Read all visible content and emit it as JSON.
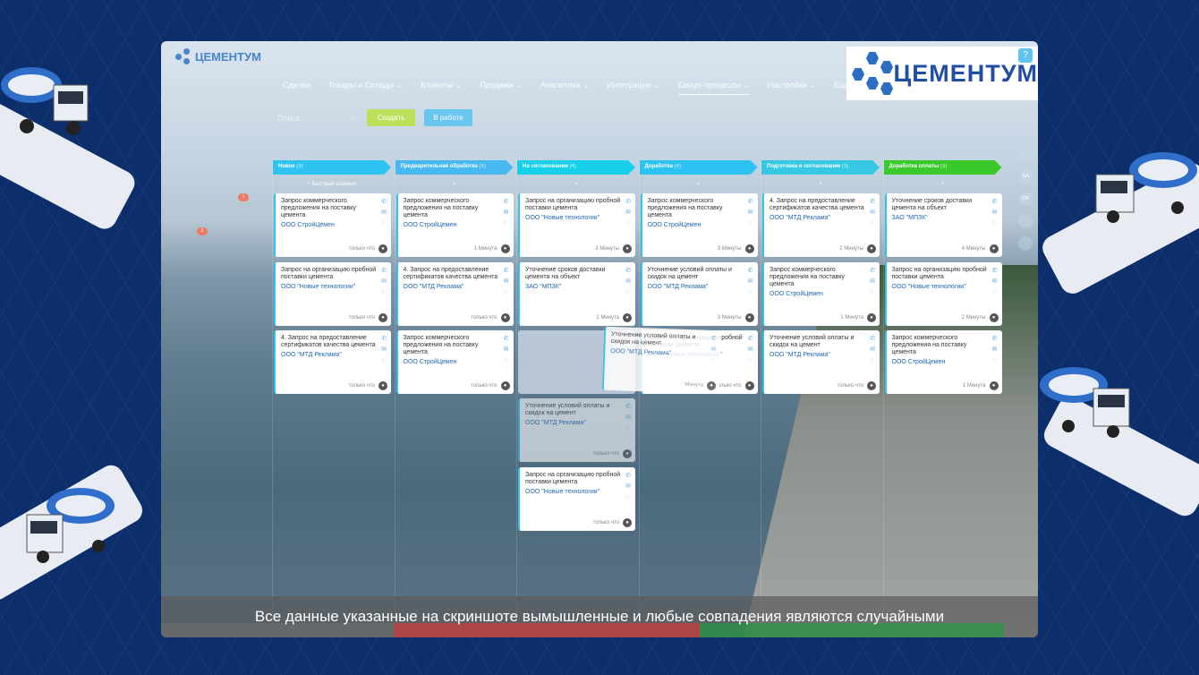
{
  "app": {
    "brand_small": "ЦЕМЕНТУМ",
    "brand_large": "ЦЕМЕНТУМ",
    "help_label": "?"
  },
  "nav": [
    "Сделки",
    "Товары и Склады ⌄",
    "Клиенты ⌄",
    "Продажи ⌄",
    "Аналитика ⌄",
    "Интеграции ⌄",
    "Смарт-процессы ⌄",
    "Настройки ⌄",
    "Ещё"
  ],
  "toolbar": {
    "search_placeholder": "Поиск",
    "create_label": "Создать",
    "work_label": "В работе"
  },
  "right_sidebar": [
    "",
    "АА",
    "ОК",
    "",
    ""
  ],
  "columns": [
    {
      "title": "Новое",
      "count": "(3)",
      "color": "#2ec3f0",
      "add_label": "+ Быстрый элемент"
    },
    {
      "title": "Предварительная обработка",
      "count": "(3)",
      "color": "#48b8f0",
      "add_label": "+"
    },
    {
      "title": "На согласовании",
      "count": "(4)",
      "color": "#15d0e8",
      "add_label": "+"
    },
    {
      "title": "Доработка",
      "count": "(4)",
      "color": "#2cc3f2",
      "add_label": "+"
    },
    {
      "title": "Подготовка и согласование",
      "count": "(3)",
      "color": "#34c8e3",
      "add_label": "+"
    },
    {
      "title": "Доработка оплаты",
      "count": "(3)",
      "color": "#39c92b",
      "add_label": "+"
    }
  ],
  "cards": [
    [
      {
        "title": "Запрос коммерческого предложения на поставку цемента",
        "company": "ООО СтройЦемен",
        "time": "только что"
      },
      {
        "title": "Запрос на организацию пробной поставки цемента",
        "company": "ООО \"Новые технологии\"",
        "time": "только что"
      },
      {
        "title": "4. Запрос на предоставление сертификатов качества цемента",
        "company": "ООО \"МТД Реклама\"",
        "time": "только что"
      }
    ],
    [
      {
        "title": "Запрос коммерческого предложения на поставку цемента",
        "company": "ООО СтройЦемен",
        "time": "1 Минута"
      },
      {
        "title": "4. Запрос на предоставление сертификатов качества цемента",
        "company": "ООО \"МТД Реклама\"",
        "time": "только что"
      },
      {
        "title": "Запрос коммерческого предложения на поставку цемента",
        "company": "ООО СтройЦемен",
        "time": "только что"
      }
    ],
    [
      {
        "title": "Запрос на организацию пробной поставки цемента",
        "company": "ООО \"Новые технологии\"",
        "time": "3 Минуты"
      },
      {
        "title": "Уточнение сроков доставки цемента на объект",
        "company": "ЗАО \"МПЗК\"",
        "time": "1 Минута"
      },
      {
        "title": "Уточнение условий оплаты и скидок на цемент",
        "company": "ООО \"МТД Реклама\"",
        "time": "только что",
        "ghost": true
      },
      {
        "title": "Запрос на организацию пробной поставки цемента",
        "company": "ООО \"Новые технологии\"",
        "time": "только что"
      }
    ],
    [
      {
        "title": "Запрос коммерческого предложения на поставку цемента",
        "company": "ООО СтройЦемен",
        "time": "3 Минуты"
      },
      {
        "title": "Уточнение условий оплаты и скидок на цемент",
        "company": "ООО \"МТД Реклама\"",
        "time": "3 Минуты"
      },
      {
        "title": "Уточнение условий оплаты и скидок на цемент",
        "company": "ООО \"МТД Реклама\"",
        "time": "Минута",
        "dragged": true
      },
      {
        "title": "Запрос на организацию пробной поставки цемента",
        "company": "ООО \"Новые технологии\"",
        "time": "только что"
      }
    ],
    [
      {
        "title": "4. Запрос на предоставление сертификатов качества цемента",
        "company": "ООО \"МТД Реклама\"",
        "time": "2 Минуты"
      },
      {
        "title": "Запрос коммерческого предложения на поставку цемента",
        "company": "ООО СтройЦемен",
        "time": "1 Минута"
      },
      {
        "title": "Уточнение условий оплаты и скидок на цемент",
        "company": "ООО \"МТД Реклама\"",
        "time": "только что"
      }
    ],
    [
      {
        "title": "Уточнение сроков доставки цемента на объект",
        "company": "ЗАО \"МПЗК\"",
        "time": "4 Минуты"
      },
      {
        "title": "Запрос на организацию пробной поставки цемента",
        "company": "ООО \"Новые технологии\"",
        "time": "2 Минуты"
      },
      {
        "title": "Запрос коммерческого предложения на поставку цемента",
        "company": "ООО СтройЦемен",
        "time": "1 Минута"
      }
    ]
  ],
  "disclaimer": "Все данные указанные на скриншоте вымышленные и любые совпадения являются случайными",
  "badges": [
    "1",
    "2"
  ]
}
